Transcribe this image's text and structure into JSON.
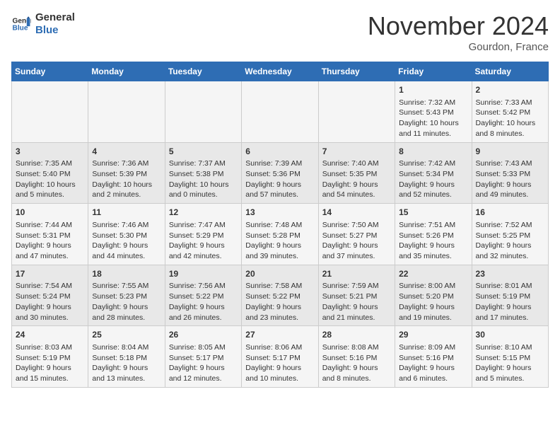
{
  "header": {
    "logo_line1": "General",
    "logo_line2": "Blue",
    "month_title": "November 2024",
    "location": "Gourdon, France"
  },
  "days_of_week": [
    "Sunday",
    "Monday",
    "Tuesday",
    "Wednesday",
    "Thursday",
    "Friday",
    "Saturday"
  ],
  "weeks": [
    [
      {
        "day": "",
        "info": ""
      },
      {
        "day": "",
        "info": ""
      },
      {
        "day": "",
        "info": ""
      },
      {
        "day": "",
        "info": ""
      },
      {
        "day": "",
        "info": ""
      },
      {
        "day": "1",
        "info": "Sunrise: 7:32 AM\nSunset: 5:43 PM\nDaylight: 10 hours and 11 minutes."
      },
      {
        "day": "2",
        "info": "Sunrise: 7:33 AM\nSunset: 5:42 PM\nDaylight: 10 hours and 8 minutes."
      }
    ],
    [
      {
        "day": "3",
        "info": "Sunrise: 7:35 AM\nSunset: 5:40 PM\nDaylight: 10 hours and 5 minutes."
      },
      {
        "day": "4",
        "info": "Sunrise: 7:36 AM\nSunset: 5:39 PM\nDaylight: 10 hours and 2 minutes."
      },
      {
        "day": "5",
        "info": "Sunrise: 7:37 AM\nSunset: 5:38 PM\nDaylight: 10 hours and 0 minutes."
      },
      {
        "day": "6",
        "info": "Sunrise: 7:39 AM\nSunset: 5:36 PM\nDaylight: 9 hours and 57 minutes."
      },
      {
        "day": "7",
        "info": "Sunrise: 7:40 AM\nSunset: 5:35 PM\nDaylight: 9 hours and 54 minutes."
      },
      {
        "day": "8",
        "info": "Sunrise: 7:42 AM\nSunset: 5:34 PM\nDaylight: 9 hours and 52 minutes."
      },
      {
        "day": "9",
        "info": "Sunrise: 7:43 AM\nSunset: 5:33 PM\nDaylight: 9 hours and 49 minutes."
      }
    ],
    [
      {
        "day": "10",
        "info": "Sunrise: 7:44 AM\nSunset: 5:31 PM\nDaylight: 9 hours and 47 minutes."
      },
      {
        "day": "11",
        "info": "Sunrise: 7:46 AM\nSunset: 5:30 PM\nDaylight: 9 hours and 44 minutes."
      },
      {
        "day": "12",
        "info": "Sunrise: 7:47 AM\nSunset: 5:29 PM\nDaylight: 9 hours and 42 minutes."
      },
      {
        "day": "13",
        "info": "Sunrise: 7:48 AM\nSunset: 5:28 PM\nDaylight: 9 hours and 39 minutes."
      },
      {
        "day": "14",
        "info": "Sunrise: 7:50 AM\nSunset: 5:27 PM\nDaylight: 9 hours and 37 minutes."
      },
      {
        "day": "15",
        "info": "Sunrise: 7:51 AM\nSunset: 5:26 PM\nDaylight: 9 hours and 35 minutes."
      },
      {
        "day": "16",
        "info": "Sunrise: 7:52 AM\nSunset: 5:25 PM\nDaylight: 9 hours and 32 minutes."
      }
    ],
    [
      {
        "day": "17",
        "info": "Sunrise: 7:54 AM\nSunset: 5:24 PM\nDaylight: 9 hours and 30 minutes."
      },
      {
        "day": "18",
        "info": "Sunrise: 7:55 AM\nSunset: 5:23 PM\nDaylight: 9 hours and 28 minutes."
      },
      {
        "day": "19",
        "info": "Sunrise: 7:56 AM\nSunset: 5:22 PM\nDaylight: 9 hours and 26 minutes."
      },
      {
        "day": "20",
        "info": "Sunrise: 7:58 AM\nSunset: 5:22 PM\nDaylight: 9 hours and 23 minutes."
      },
      {
        "day": "21",
        "info": "Sunrise: 7:59 AM\nSunset: 5:21 PM\nDaylight: 9 hours and 21 minutes."
      },
      {
        "day": "22",
        "info": "Sunrise: 8:00 AM\nSunset: 5:20 PM\nDaylight: 9 hours and 19 minutes."
      },
      {
        "day": "23",
        "info": "Sunrise: 8:01 AM\nSunset: 5:19 PM\nDaylight: 9 hours and 17 minutes."
      }
    ],
    [
      {
        "day": "24",
        "info": "Sunrise: 8:03 AM\nSunset: 5:19 PM\nDaylight: 9 hours and 15 minutes."
      },
      {
        "day": "25",
        "info": "Sunrise: 8:04 AM\nSunset: 5:18 PM\nDaylight: 9 hours and 13 minutes."
      },
      {
        "day": "26",
        "info": "Sunrise: 8:05 AM\nSunset: 5:17 PM\nDaylight: 9 hours and 12 minutes."
      },
      {
        "day": "27",
        "info": "Sunrise: 8:06 AM\nSunset: 5:17 PM\nDaylight: 9 hours and 10 minutes."
      },
      {
        "day": "28",
        "info": "Sunrise: 8:08 AM\nSunset: 5:16 PM\nDaylight: 9 hours and 8 minutes."
      },
      {
        "day": "29",
        "info": "Sunrise: 8:09 AM\nSunset: 5:16 PM\nDaylight: 9 hours and 6 minutes."
      },
      {
        "day": "30",
        "info": "Sunrise: 8:10 AM\nSunset: 5:15 PM\nDaylight: 9 hours and 5 minutes."
      }
    ]
  ]
}
